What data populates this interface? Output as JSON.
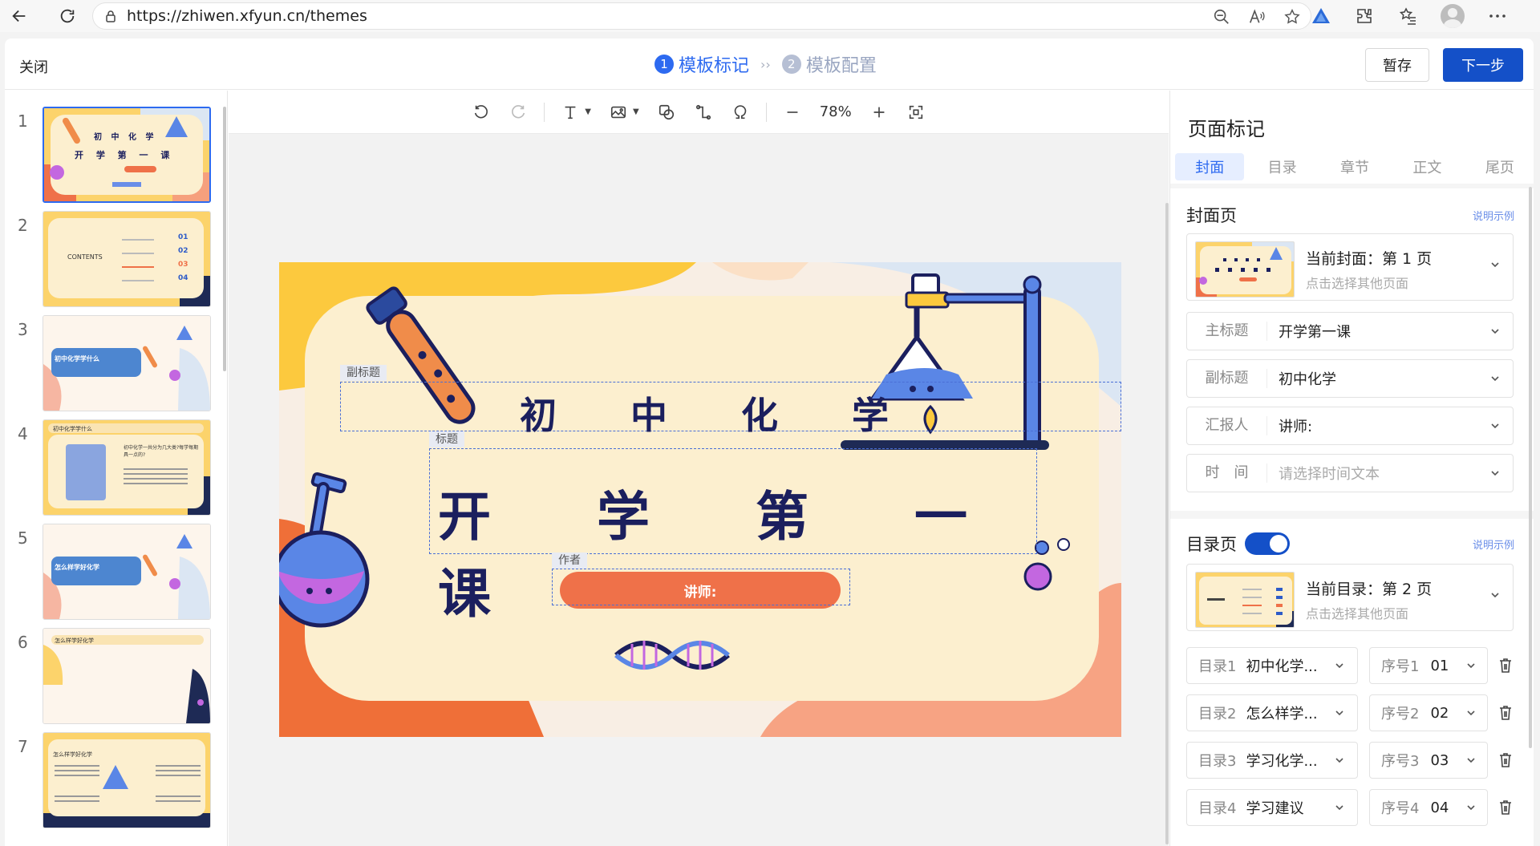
{
  "browser": {
    "url": "https://zhiwen.xfyun.cn/themes"
  },
  "header": {
    "close_label": "关闭",
    "steps": [
      {
        "num": "1",
        "label": "模板标记"
      },
      {
        "num": "2",
        "label": "模板配置"
      }
    ],
    "step_separator": "››",
    "save_label": "暂存",
    "next_label": "下一步"
  },
  "thumbnails": [
    {
      "num": "1",
      "selected": true
    },
    {
      "num": "2",
      "selected": false
    },
    {
      "num": "3",
      "selected": false
    },
    {
      "num": "4",
      "selected": false
    },
    {
      "num": "5",
      "selected": false
    },
    {
      "num": "6",
      "selected": false
    },
    {
      "num": "7",
      "selected": false
    }
  ],
  "thumb_text": {
    "t1_line1": "初 中 化 学",
    "t1_line2": "开 学 第 一 课",
    "t2_contents": "CONTENTS",
    "t2_nums": [
      "01",
      "02",
      "03",
      "04"
    ],
    "t3_title": "初中化学学什么",
    "t4_title": "初中化学学什么",
    "t4_q": "初中化学一共分为几大类?每学每期具一点的?",
    "t5_title": "怎么样学好化学",
    "t6_title": "怎么样学好化学",
    "t7_title": "怎么样学好化学"
  },
  "toolbar": {
    "zoom": "78%"
  },
  "slide": {
    "subtitle_text": "初　　中　　化　　学",
    "title_text": "开　　学　　第　　一　　课",
    "presenter_text": "讲师:",
    "labels": {
      "subtitle": "副标题",
      "title": "标题",
      "author": "作者"
    }
  },
  "panel": {
    "title": "页面标记",
    "tabs": [
      "封面",
      "目录",
      "章节",
      "正文",
      "尾页"
    ],
    "active_tab": "封面",
    "cover": {
      "heading": "封面页",
      "help": "说明示例",
      "current": "当前封面：第 1 页",
      "hint": "点击选择其他页面",
      "fields": [
        {
          "label": "主标题",
          "value": "开学第一课",
          "placeholder": false
        },
        {
          "label": "副标题",
          "value": "初中化学",
          "placeholder": false
        },
        {
          "label": "汇报人",
          "value": "讲师:",
          "placeholder": false
        },
        {
          "label": "时　间",
          "value": "请选择时间文本",
          "placeholder": true
        }
      ]
    },
    "toc": {
      "heading": "目录页",
      "help": "说明示例",
      "toggle_on": true,
      "current": "当前目录：第 2 页",
      "hint": "点击选择其他页面",
      "items": [
        {
          "label": "目录1",
          "value": "初中化学...",
          "num_label": "序号1",
          "num": "01"
        },
        {
          "label": "目录2",
          "value": "怎么样学...",
          "num_label": "序号2",
          "num": "02"
        },
        {
          "label": "目录3",
          "value": "学习化学...",
          "num_label": "序号3",
          "num": "03"
        },
        {
          "label": "目录4",
          "value": "学习建议",
          "num_label": "序号4",
          "num": "04"
        }
      ]
    }
  },
  "colors": {
    "accent": "#2d6af0",
    "primary_button": "#1450c8",
    "slide_orange": "#ef7149",
    "slide_cream": "#fcefcf",
    "slide_navy": "#1b1f5e"
  }
}
